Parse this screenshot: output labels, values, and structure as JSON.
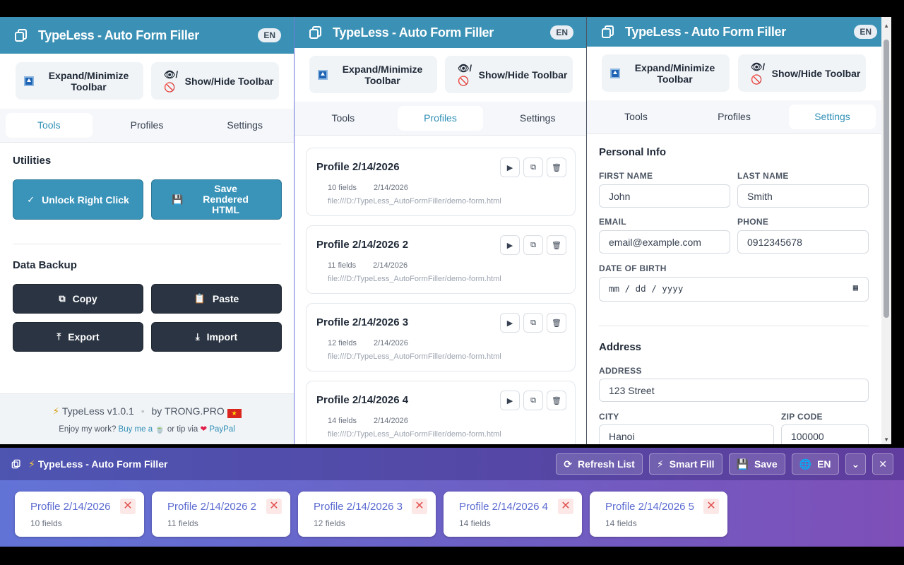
{
  "app_title": "TypeLess - Auto Form Filler",
  "lang": "EN",
  "toolbar_buttons": {
    "expand": "Expand/Minimize Toolbar",
    "showhide": "Show/Hide Toolbar"
  },
  "tabs": [
    "Tools",
    "Profiles",
    "Settings"
  ],
  "tools": {
    "utilities": "Utilities",
    "unlock": "Unlock Right Click",
    "save_html": "Save Rendered HTML",
    "backup": "Data Backup",
    "copy": "Copy",
    "paste": "Paste",
    "export": "Export",
    "import": "Import"
  },
  "footer": {
    "version": "TypeLess v1.0.1",
    "by": "by TRONG.PRO",
    "enjoy": "Enjoy my work? ",
    "buy": "Buy me a",
    "tip": " or tip via ",
    "paypal": "PayPal"
  },
  "profiles": [
    {
      "name": "Profile 2/14/2026",
      "fields": "10 fields",
      "date": "2/14/2026",
      "url": "file:///D:/TypeLess_AutoFormFiller/demo-form.html"
    },
    {
      "name": "Profile 2/14/2026 2",
      "fields": "11 fields",
      "date": "2/14/2026",
      "url": "file:///D:/TypeLess_AutoFormFiller/demo-form.html"
    },
    {
      "name": "Profile 2/14/2026 3",
      "fields": "12 fields",
      "date": "2/14/2026",
      "url": "file:///D:/TypeLess_AutoFormFiller/demo-form.html"
    },
    {
      "name": "Profile 2/14/2026 4",
      "fields": "14 fields",
      "date": "2/14/2026",
      "url": "file:///D:/TypeLess_AutoFormFiller/demo-form.html"
    }
  ],
  "settings": {
    "personal": "Personal Info",
    "first_name_label": "FIRST NAME",
    "first_name": "John",
    "last_name_label": "LAST NAME",
    "last_name": "Smith",
    "email_label": "EMAIL",
    "email": "email@example.com",
    "phone_label": "PHONE",
    "phone": "0912345678",
    "dob_label": "DATE OF BIRTH",
    "dob": "mm / dd / yyyy",
    "address_section": "Address",
    "address_label": "ADDRESS",
    "address": "123 Street",
    "city_label": "CITY",
    "city": "Hanoi",
    "zip_label": "ZIP CODE",
    "zip": "100000"
  },
  "floating_toolbar": {
    "title": "TypeLess - Auto Form Filler",
    "refresh": "Refresh List",
    "smart_fill": "Smart Fill",
    "save": "Save",
    "lang": "EN",
    "chips": [
      {
        "name": "Profile 2/14/2026",
        "fields": "10 fields"
      },
      {
        "name": "Profile 2/14/2026 2",
        "fields": "11 fields"
      },
      {
        "name": "Profile 2/14/2026 3",
        "fields": "12 fields"
      },
      {
        "name": "Profile 2/14/2026 4",
        "fields": "14 fields"
      },
      {
        "name": "Profile 2/14/2026 5",
        "fields": "14 fields"
      }
    ]
  },
  "colors": {
    "header": "#3b91b5",
    "accent": "#2f8fb6",
    "dark_button": "#2a3442",
    "toolbar_gradient_start": "#6273d6",
    "toolbar_gradient_end": "#7e4fb8"
  }
}
